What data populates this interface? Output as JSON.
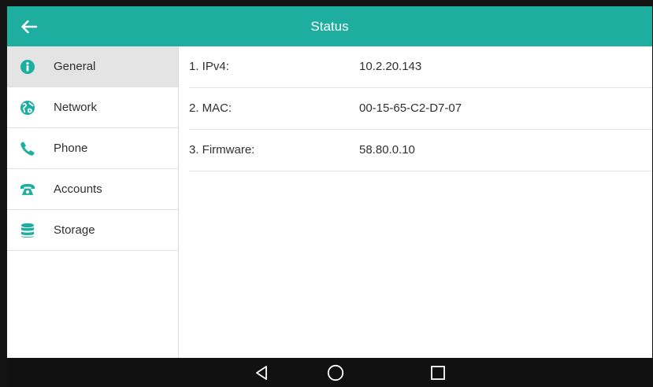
{
  "header": {
    "title": "Status",
    "accent_color": "#1daea0"
  },
  "sidebar": {
    "items": [
      {
        "label": "General",
        "icon": "info-icon",
        "active": true
      },
      {
        "label": "Network",
        "icon": "globe-icon",
        "active": false
      },
      {
        "label": "Phone",
        "icon": "phone-handset-icon",
        "active": false
      },
      {
        "label": "Accounts",
        "icon": "desk-phone-icon",
        "active": false
      },
      {
        "label": "Storage",
        "icon": "database-icon",
        "active": false
      }
    ]
  },
  "main": {
    "rows": [
      {
        "label": "1. IPv4:",
        "value": "10.2.20.143"
      },
      {
        "label": "2. MAC:",
        "value": "00-15-65-C2-D7-07"
      },
      {
        "label": "3. Firmware:",
        "value": "58.80.0.10"
      }
    ]
  },
  "navbar": {
    "buttons": [
      "back-triangle-icon",
      "home-circle-icon",
      "recents-square-icon"
    ]
  }
}
